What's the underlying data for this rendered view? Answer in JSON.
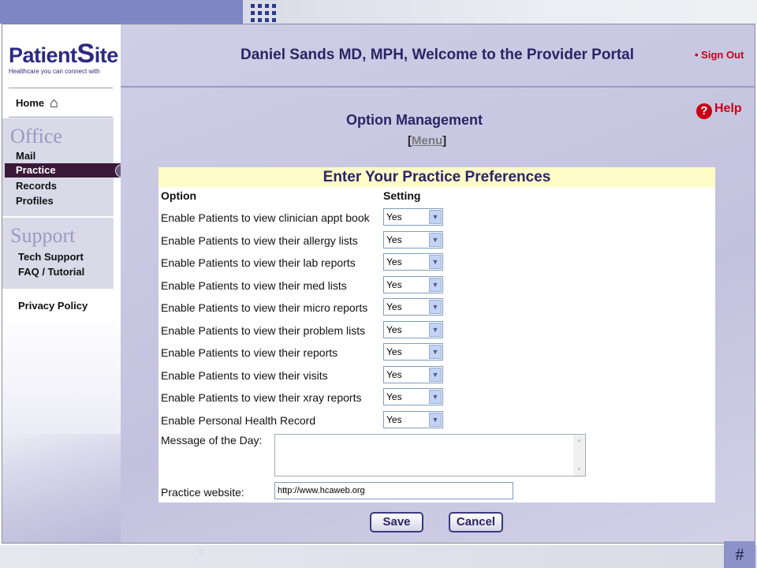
{
  "slide": {
    "page_number": "#",
    "footer_mark": "::"
  },
  "app": {
    "logo": {
      "name_part1": "Patient",
      "name_part2": "S",
      "name_part3": "ite",
      "tagline": "Healthcare you can connect with"
    },
    "sidebar": {
      "home": "Home",
      "office_title": "Office",
      "office_items": [
        "Mail",
        "Practice",
        "Records",
        "Profiles"
      ],
      "support_title": "Support",
      "support_items": [
        "Tech Support",
        "FAQ / Tutorial"
      ],
      "privacy": "Privacy Policy"
    },
    "header": {
      "welcome": "Daniel Sands MD, MPH, Welcome to the Provider Portal",
      "sign_out": "• Sign Out",
      "help": "Help"
    },
    "page": {
      "title": "Option Management",
      "menu_link": "Menu",
      "panel_title": "Enter Your Practice Preferences",
      "col_option": "Option",
      "col_setting": "Setting",
      "options": [
        {
          "label": "Enable Patients to view clinician appt book",
          "value": "Yes"
        },
        {
          "label": "Enable Patients to view their allergy lists",
          "value": "Yes"
        },
        {
          "label": "Enable Patients to view their lab reports",
          "value": "Yes"
        },
        {
          "label": "Enable Patients to view their med lists",
          "value": "Yes"
        },
        {
          "label": "Enable Patients to view their micro reports",
          "value": "Yes"
        },
        {
          "label": "Enable Patients to view their problem lists",
          "value": "Yes"
        },
        {
          "label": "Enable Patients to view their reports",
          "value": "Yes"
        },
        {
          "label": "Enable Patients to view their visits",
          "value": "Yes"
        },
        {
          "label": "Enable Patients to view their xray reports",
          "value": "Yes"
        },
        {
          "label": "Enable Personal Health Record",
          "value": "Yes"
        }
      ],
      "motd_label": "Message of the Day:",
      "motd_value": "",
      "website_label": "Practice website:",
      "website_value": "http://www.hcaweb.org",
      "save": "Save",
      "cancel": "Cancel"
    }
  }
}
